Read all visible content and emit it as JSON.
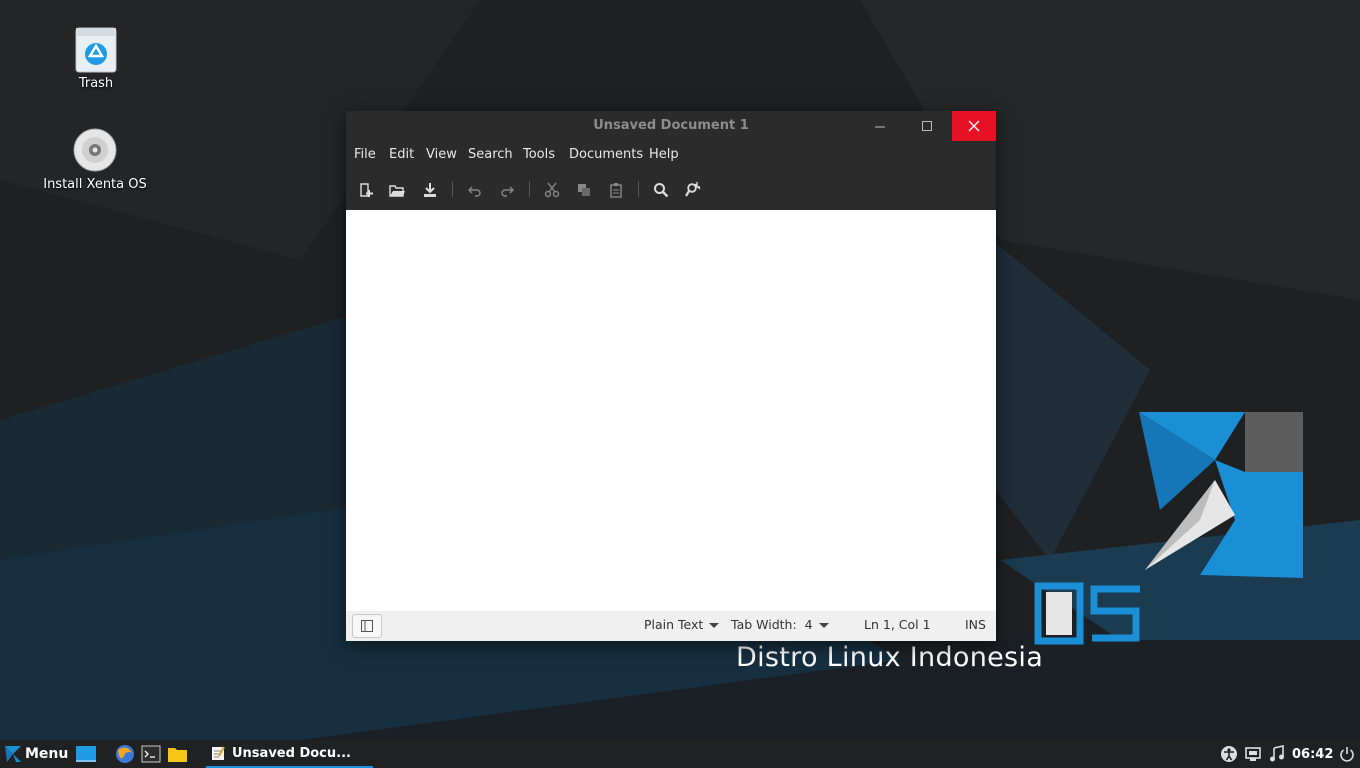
{
  "desktop": {
    "icons": [
      {
        "label": "Trash",
        "icon": "trash-icon"
      },
      {
        "label": "Install Xenta OS",
        "icon": "cd-icon"
      }
    ],
    "brand_tagline": "Distro Linux Indonesia",
    "brand_os_text": "OS"
  },
  "window": {
    "title": "Unsaved Document 1",
    "menu": [
      "File",
      "Edit",
      "View",
      "Search",
      "Tools",
      "Documents",
      "Help"
    ],
    "toolbar": [
      "new-document-icon",
      "open-icon",
      "save-icon",
      "undo-icon",
      "redo-icon",
      "cut-icon",
      "copy-icon",
      "paste-icon",
      "find-icon",
      "replace-icon"
    ],
    "editor_text": "",
    "status": {
      "language": "Plain Text",
      "tab_width_label": "Tab Width:",
      "tab_width_value": "4",
      "position": "Ln 1, Col 1",
      "mode": "INS"
    }
  },
  "taskbar": {
    "menu_label": "Menu",
    "active_window_label": "Unsaved Docu...",
    "clock": "06:42",
    "accent_color": "#1a90e0"
  }
}
